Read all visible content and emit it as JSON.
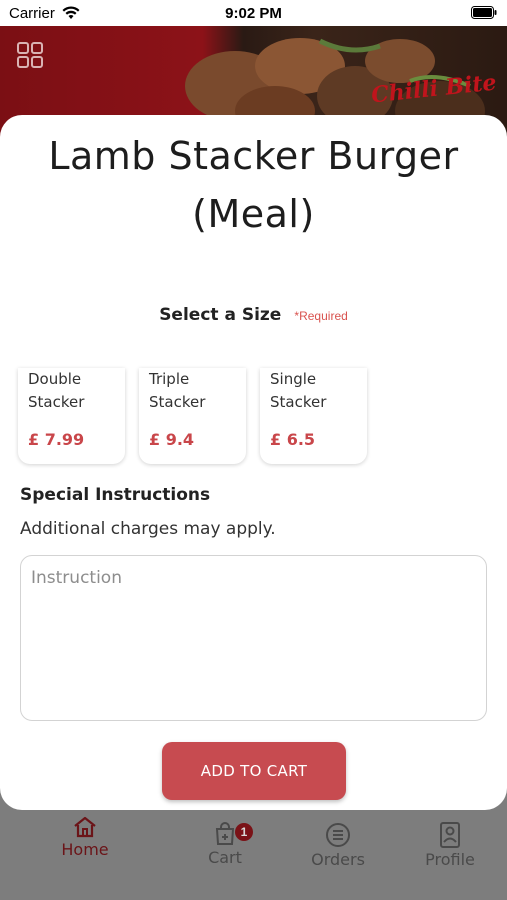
{
  "status_bar": {
    "carrier": "Carrier",
    "time": "9:02 PM",
    "wifi_icon": "wifi-icon",
    "battery_icon": "battery-icon"
  },
  "hero": {
    "menu_icon": "grid-icon",
    "logo_text": "Chilli Bite"
  },
  "item": {
    "title_line1": "Lamb Stacker Burger",
    "title_line2": "(Meal)",
    "size_title": "Select a Size",
    "required": "*Required",
    "sizes": [
      {
        "name_line1": "Double",
        "name_line2": "Stacker",
        "price": "£ 7.99"
      },
      {
        "name_line1": "Triple",
        "name_line2": "Stacker",
        "price": "£ 9.4"
      },
      {
        "name_line1": "Single",
        "name_line2": "Stacker",
        "price": "£ 6.5"
      }
    ],
    "special_title": "Special Instructions",
    "special_note": "Additional charges may apply.",
    "instruction_placeholder": "Instruction",
    "add_button": "ADD TO CART"
  },
  "tabs": [
    {
      "label": "Home",
      "icon": "home-icon",
      "active": true
    },
    {
      "label": "Cart",
      "icon": "cart-icon",
      "badge": "1"
    },
    {
      "label": "Orders",
      "icon": "orders-icon"
    },
    {
      "label": "Profile",
      "icon": "profile-icon"
    }
  ],
  "colors": {
    "accent": "#c74b50",
    "price": "#c9464a",
    "brand_dark": "#7a1217",
    "overlay": "#7d7d7d"
  }
}
